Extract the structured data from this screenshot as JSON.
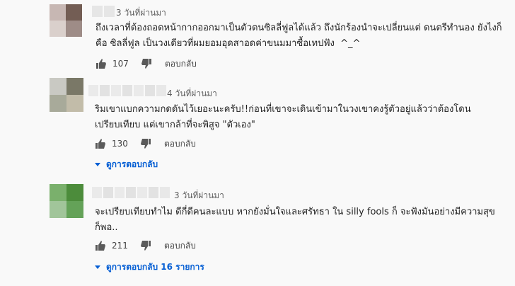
{
  "comments": [
    {
      "time": "3 วันที่ผ่านมา",
      "text": "ถึงเวลาที่ต้องถอดหน้ากากออกมาเป็นตัวตนซิลลี่ฟูลได้แล้ว ถึงนักร้องนำจะเปลี่ยนแต่ ดนตรีทำนอง ยังไงก็คือ ซิลลี่ฟูล เป็นวงเดียวที่ผมยอมอุดสาอดค่าขนมมาซื้อเทปฟัง  ^_^",
      "likes": "107",
      "reply_label": "ตอบกลับ",
      "avatar_colors": [
        "#c7b7b3",
        "#735d54",
        "#dad0cc",
        "#9e8c87"
      ]
    },
    {
      "time": "4 วันที่ผ่านมา",
      "text": "ริมเขาแบกความกดดันไว้เยอะนะครับ!!ก่อนที่เขาจะเดินเข้ามาในวงเขาคงรู้ตัวอยู่แล้วว่าต้องโดนเปรียบเทียบ แต่เขากล้าที่จะพิสูจ \"ตัวเอง\"",
      "likes": "130",
      "reply_label": "ตอบกลับ",
      "view_replies": "ดูการตอบกลับ",
      "avatar_colors": [
        "#c9c9c3",
        "#7a7867",
        "#a8aa9a",
        "#c2bca9"
      ]
    },
    {
      "time": "3 วันที่ผ่านมา",
      "text": "จะเปรียบเทียบทำไม ดีกี่ดีคนละแบบ หากยังมั่นใจและศรัทธา ใน silly fools ก็ จะฟังมันอย่างมีความสุขก็พอ..",
      "likes": "211",
      "reply_label": "ตอบกลับ",
      "view_replies": "ดูการตอบกลับ 16 รายการ",
      "avatar_colors": [
        "#7ab06c",
        "#4c8c3b",
        "#a1c59a",
        "#64a258"
      ]
    }
  ],
  "colors": {
    "link_blue": "#065fd4",
    "meta_gray": "#606060"
  },
  "icons": [
    "thumbs-up-icon",
    "thumbs-down-icon",
    "caret-down-icon"
  ]
}
